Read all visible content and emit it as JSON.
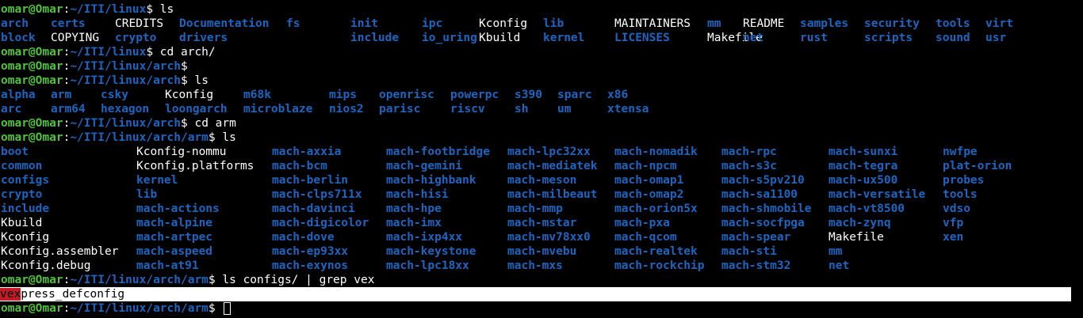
{
  "prompt": {
    "user": "omar@Omar",
    "sep": ":"
  },
  "lines": [
    {
      "type": "prompt",
      "path": "~/ITI/linux",
      "cmd": " ls"
    },
    {
      "type": "list",
      "items": [
        {
          "t": "arch",
          "d": true
        },
        {
          "t": "certs",
          "d": true
        },
        {
          "t": "CREDITS",
          "d": false
        },
        {
          "t": "Documentation",
          "d": true
        },
        {
          "t": "fs",
          "d": true
        },
        {
          "t": "init",
          "d": true
        },
        {
          "t": "ipc",
          "d": true
        },
        {
          "t": "Kconfig",
          "d": false
        },
        {
          "t": "lib",
          "d": true
        },
        {
          "t": "MAINTAINERS",
          "d": false
        },
        {
          "t": "mm",
          "d": true
        },
        {
          "t": "README",
          "d": false
        },
        {
          "t": "samples",
          "d": true
        },
        {
          "t": "security",
          "d": true
        },
        {
          "t": "tools",
          "d": true
        },
        {
          "t": "virt",
          "d": true
        }
      ]
    },
    {
      "type": "list",
      "items": [
        {
          "t": "block",
          "d": true
        },
        {
          "t": "COPYING",
          "d": false
        },
        {
          "t": "crypto",
          "d": true
        },
        {
          "t": "drivers",
          "d": true
        },
        {
          "t": "",
          "d": false
        },
        {
          "t": "include",
          "d": true
        },
        {
          "t": "io_uring",
          "d": true
        },
        {
          "t": "Kbuild",
          "d": false
        },
        {
          "t": "kernel",
          "d": true
        },
        {
          "t": "LICENSES",
          "d": true
        },
        {
          "t": "Makefile",
          "d": false
        },
        {
          "t": "net",
          "d": true
        },
        {
          "t": "rust",
          "d": true
        },
        {
          "t": "scripts",
          "d": true
        },
        {
          "t": "sound",
          "d": true
        },
        {
          "t": "usr",
          "d": true
        }
      ]
    },
    {
      "type": "prompt",
      "path": "~/ITI/linux",
      "cmd": " cd arch/"
    },
    {
      "type": "prompt",
      "path": "~/ITI/linux/arch",
      "cmd": ""
    },
    {
      "type": "prompt",
      "path": "~/ITI/linux/arch",
      "cmd": " ls"
    },
    {
      "type": "list",
      "items": [
        {
          "t": "alpha",
          "d": true
        },
        {
          "t": "arm",
          "d": true
        },
        {
          "t": "csky",
          "d": true
        },
        {
          "t": "Kconfig",
          "d": false
        },
        {
          "t": "m68k",
          "d": true
        },
        {
          "t": "mips",
          "d": true
        },
        {
          "t": "openrisc",
          "d": true
        },
        {
          "t": "powerpc",
          "d": true
        },
        {
          "t": "s390",
          "d": true
        },
        {
          "t": "sparc",
          "d": true
        },
        {
          "t": "x86",
          "d": true
        }
      ]
    },
    {
      "type": "list",
      "items": [
        {
          "t": "arc",
          "d": true
        },
        {
          "t": "arm64",
          "d": true
        },
        {
          "t": "hexagon",
          "d": true
        },
        {
          "t": "loongarch",
          "d": true
        },
        {
          "t": "microblaze",
          "d": true
        },
        {
          "t": "nios2",
          "d": true
        },
        {
          "t": "parisc",
          "d": true
        },
        {
          "t": "riscv",
          "d": true
        },
        {
          "t": "sh",
          "d": true
        },
        {
          "t": "um",
          "d": true
        },
        {
          "t": "xtensa",
          "d": true
        }
      ]
    },
    {
      "type": "prompt",
      "path": "~/ITI/linux/arch",
      "cmd": " cd arm"
    },
    {
      "type": "prompt",
      "path": "~/ITI/linux/arch/arm",
      "cmd": " ls"
    },
    {
      "type": "list",
      "items": [
        {
          "t": "boot",
          "d": true
        },
        {
          "t": "Kconfig-nommu",
          "d": false
        },
        {
          "t": "mach-axxia",
          "d": true
        },
        {
          "t": "mach-footbridge",
          "d": true
        },
        {
          "t": "mach-lpc32xx",
          "d": true
        },
        {
          "t": "mach-nomadik",
          "d": true
        },
        {
          "t": "mach-rpc",
          "d": true
        },
        {
          "t": "mach-sunxi",
          "d": true
        },
        {
          "t": "nwfpe",
          "d": true
        }
      ]
    },
    {
      "type": "list",
      "items": [
        {
          "t": "common",
          "d": true
        },
        {
          "t": "Kconfig.platforms",
          "d": false
        },
        {
          "t": "mach-bcm",
          "d": true
        },
        {
          "t": "mach-gemini",
          "d": true
        },
        {
          "t": "mach-mediatek",
          "d": true
        },
        {
          "t": "mach-npcm",
          "d": true
        },
        {
          "t": "mach-s3c",
          "d": true
        },
        {
          "t": "mach-tegra",
          "d": true
        },
        {
          "t": "plat-orion",
          "d": true
        }
      ]
    },
    {
      "type": "list",
      "items": [
        {
          "t": "configs",
          "d": true
        },
        {
          "t": "kernel",
          "d": true
        },
        {
          "t": "mach-berlin",
          "d": true
        },
        {
          "t": "mach-highbank",
          "d": true
        },
        {
          "t": "mach-meson",
          "d": true
        },
        {
          "t": "mach-omap1",
          "d": true
        },
        {
          "t": "mach-s5pv210",
          "d": true
        },
        {
          "t": "mach-ux500",
          "d": true
        },
        {
          "t": "probes",
          "d": true
        }
      ]
    },
    {
      "type": "list",
      "items": [
        {
          "t": "crypto",
          "d": true
        },
        {
          "t": "lib",
          "d": true
        },
        {
          "t": "mach-clps711x",
          "d": true
        },
        {
          "t": "mach-hisi",
          "d": true
        },
        {
          "t": "mach-milbeaut",
          "d": true
        },
        {
          "t": "mach-omap2",
          "d": true
        },
        {
          "t": "mach-sa1100",
          "d": true
        },
        {
          "t": "mach-versatile",
          "d": true
        },
        {
          "t": "tools",
          "d": true
        }
      ]
    },
    {
      "type": "list",
      "items": [
        {
          "t": "include",
          "d": true
        },
        {
          "t": "mach-actions",
          "d": true
        },
        {
          "t": "mach-davinci",
          "d": true
        },
        {
          "t": "mach-hpe",
          "d": true
        },
        {
          "t": "mach-mmp",
          "d": true
        },
        {
          "t": "mach-orion5x",
          "d": true
        },
        {
          "t": "mach-shmobile",
          "d": true
        },
        {
          "t": "mach-vt8500",
          "d": true
        },
        {
          "t": "vdso",
          "d": true
        }
      ]
    },
    {
      "type": "list",
      "items": [
        {
          "t": "Kbuild",
          "d": false
        },
        {
          "t": "mach-alpine",
          "d": true
        },
        {
          "t": "mach-digicolor",
          "d": true
        },
        {
          "t": "mach-imx",
          "d": true
        },
        {
          "t": "mach-mstar",
          "d": true
        },
        {
          "t": "mach-pxa",
          "d": true
        },
        {
          "t": "mach-socfpga",
          "d": true
        },
        {
          "t": "mach-zynq",
          "d": true
        },
        {
          "t": "vfp",
          "d": true
        }
      ]
    },
    {
      "type": "list",
      "items": [
        {
          "t": "Kconfig",
          "d": false
        },
        {
          "t": "mach-artpec",
          "d": true
        },
        {
          "t": "mach-dove",
          "d": true
        },
        {
          "t": "mach-ixp4xx",
          "d": true
        },
        {
          "t": "mach-mv78xx0",
          "d": true
        },
        {
          "t": "mach-qcom",
          "d": true
        },
        {
          "t": "mach-spear",
          "d": true
        },
        {
          "t": "Makefile",
          "d": false
        },
        {
          "t": "xen",
          "d": true
        }
      ]
    },
    {
      "type": "list",
      "items": [
        {
          "t": "Kconfig.assembler",
          "d": false
        },
        {
          "t": "mach-aspeed",
          "d": true
        },
        {
          "t": "mach-ep93xx",
          "d": true
        },
        {
          "t": "mach-keystone",
          "d": true
        },
        {
          "t": "mach-mvebu",
          "d": true
        },
        {
          "t": "mach-realtek",
          "d": true
        },
        {
          "t": "mach-sti",
          "d": true
        },
        {
          "t": "mm",
          "d": true
        }
      ]
    },
    {
      "type": "list",
      "items": [
        {
          "t": "Kconfig.debug",
          "d": false
        },
        {
          "t": "mach-at91",
          "d": true
        },
        {
          "t": "mach-exynos",
          "d": true
        },
        {
          "t": "mach-lpc18xx",
          "d": true
        },
        {
          "t": "mach-mxs",
          "d": true
        },
        {
          "t": "mach-rockchip",
          "d": true
        },
        {
          "t": "mach-stm32",
          "d": true
        },
        {
          "t": "net",
          "d": true
        }
      ]
    },
    {
      "type": "prompt",
      "path": "~/ITI/linux/arch/arm",
      "cmd": " ls configs/ | grep vex"
    },
    {
      "type": "grep",
      "match": "vex",
      "rest": "press_defconfig"
    },
    {
      "type": "prompt",
      "path": "~/ITI/linux/arch/arm",
      "cmd": " ",
      "cursor": true
    }
  ],
  "colors": {
    "background": "#000000",
    "user": "#4ec43a",
    "path": "#1c66c2",
    "directory": "#1c66c2",
    "file": "#ffffff",
    "match": "#c01c28",
    "highlight_row": "#ffffff"
  }
}
